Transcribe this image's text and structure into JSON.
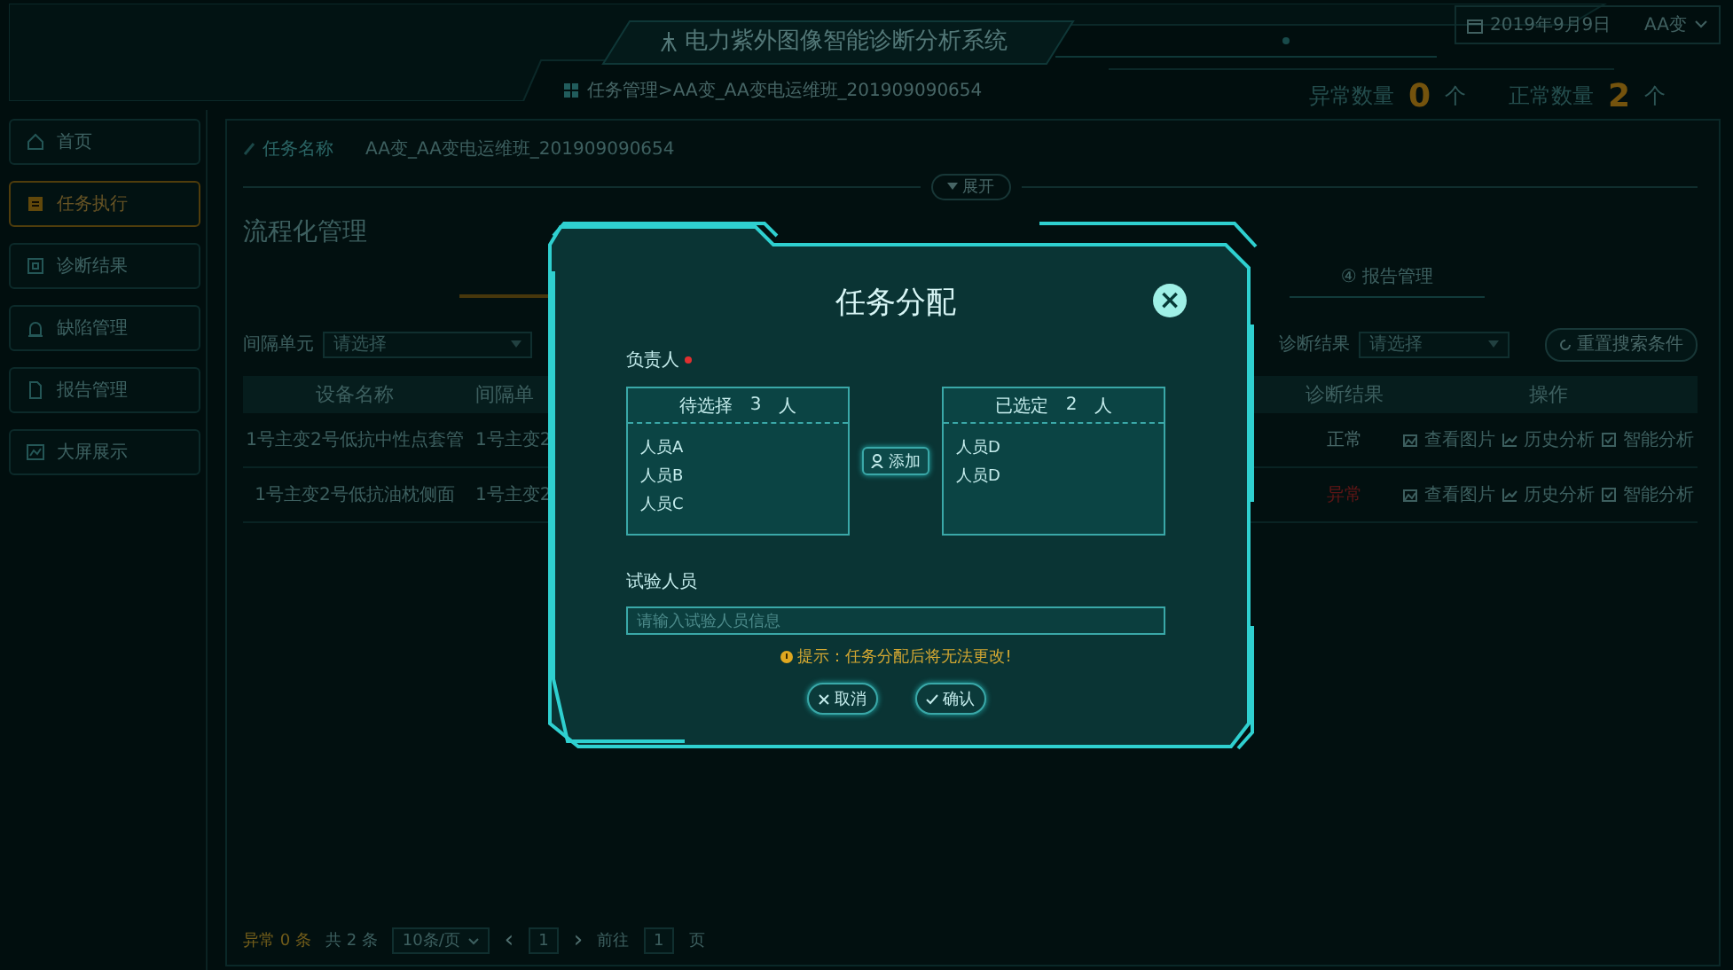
{
  "header": {
    "title": "电力紫外图像智能诊断分析系统",
    "date": "2019年9月9日",
    "station": "AA变",
    "breadcrumb": "任务管理>AA变_AA变电运维班_201909090654",
    "stats": [
      {
        "label": "异常数量",
        "value": "0",
        "unit": "个"
      },
      {
        "label": "正常数量",
        "value": "2",
        "unit": "个"
      }
    ]
  },
  "sidebar": {
    "items": [
      {
        "label": "首页",
        "selected": false
      },
      {
        "label": "任务执行",
        "selected": true
      },
      {
        "label": "诊断结果",
        "selected": false
      },
      {
        "label": "缺陷管理",
        "selected": false
      },
      {
        "label": "报告管理",
        "selected": false
      },
      {
        "label": "大屏展示",
        "selected": false
      }
    ]
  },
  "task": {
    "label": "任务名称",
    "value": "AA变_AA变电运维班_201909090654",
    "expand": "展开"
  },
  "section_title": "流程化管理",
  "steps": [
    {
      "number": "④",
      "label": "报告管理"
    }
  ],
  "filters": [
    {
      "label": "间隔单元",
      "placeholder": "请选择"
    },
    {
      "label": "诊断结果",
      "placeholder": "请选择"
    }
  ],
  "reset_button": "重置搜索条件",
  "table": {
    "columns": [
      "设备名称",
      "间隔单",
      "诊断结果",
      "操作"
    ],
    "rows": [
      {
        "device": "1号主变2号低抗中性点套管",
        "bay": "1号主变2",
        "result": "正常",
        "abnormal": false,
        "actions": [
          "查看图片",
          "历史分析",
          "智能分析"
        ]
      },
      {
        "device": "1号主变2号低抗油枕侧面",
        "bay": "1号主变2",
        "result": "异常",
        "abnormal": true,
        "actions": [
          "查看图片",
          "历史分析",
          "智能分析"
        ]
      }
    ]
  },
  "pagination": {
    "abnormal": "异常 0 条",
    "total": "共 2 条",
    "page_size": "10条/页",
    "prev": "‹",
    "current": "1",
    "next": "›",
    "goto": "前往",
    "goto_value": "1",
    "page": "页"
  },
  "dialog": {
    "title": "任务分配",
    "close": "×",
    "owner_label": "负责人",
    "required": true,
    "available": {
      "title": "待选择",
      "count": "3",
      "unit": "人",
      "items": [
        "人员A",
        "人员B",
        "人员C"
      ]
    },
    "add_button": "添加",
    "chosen": {
      "title": "已选定",
      "count": "2",
      "unit": "人",
      "items": [
        "人员D",
        "人员D"
      ]
    },
    "tester_label": "试验人员",
    "tester_placeholder": "请输入试验人员信息",
    "hint": "提示：任务分配后将无法更改!",
    "buttons": [
      {
        "kind": "cancel",
        "label": "取消"
      },
      {
        "kind": "confirm",
        "label": "确认"
      }
    ]
  }
}
